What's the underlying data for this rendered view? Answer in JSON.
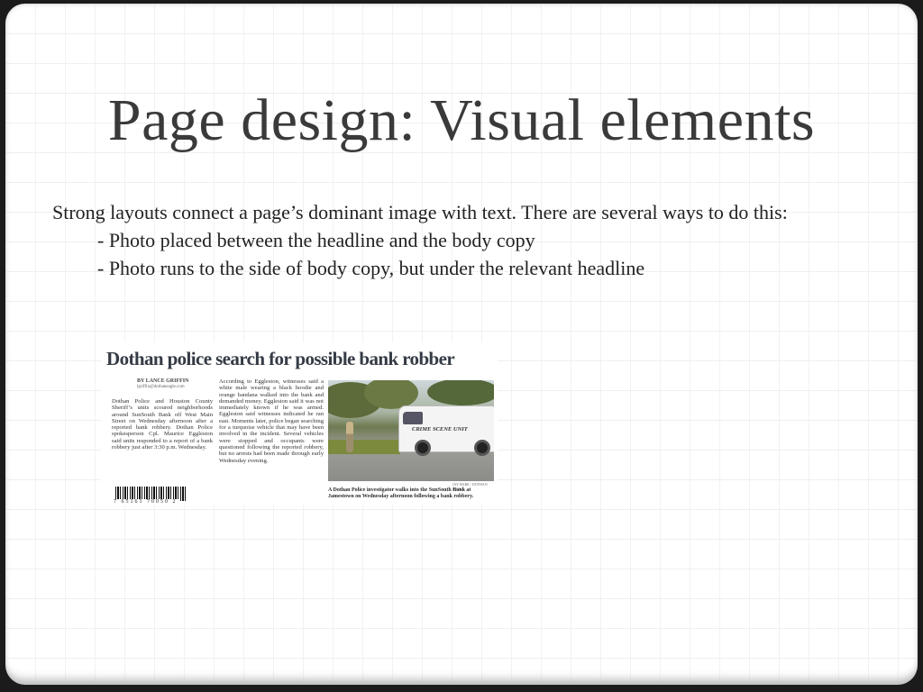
{
  "slide": {
    "title": "Page design: Visual elements",
    "body_line1": "Strong layouts connect a page’s dominant image with text. There are several ways to do this:",
    "bullets": [
      "- Photo placed between the headline and the body copy",
      "- Photo runs to the side of body copy, but under the relevant headline"
    ]
  },
  "clipping": {
    "headline": "Dothan police search for possible bank robber",
    "byline": "BY LANCE GRIFFIN",
    "email": "lgriffin@dothaneagle.com",
    "col1": "Dothan Police and Houston County Sheriff’s units scoured neighborhoods around SunSouth Bank off West Main Street on Wednesday afternoon after a reported bank robbery. Dothan Police spokesperson Cpl. Maurice Eggleston said units responded to a report of a bank robbery just after 3:30 p.m. Wednesday.",
    "col2": "According to Eggleston, witnesses said a white male wearing a black hoodie and orange bandana walked into the bank and demanded money. Eggleston said it was not immediately known if he was armed. Eggleston said witnesses indicated he ran east. Moments later, police began searching for a turquoise vehicle that may have been involved in the incident. Several vehicles were stopped and occupants were questioned following the reported robbery, but no arrests had been made through early Wednesday evening.",
    "van_text": "CRIME SCENE UNIT",
    "photo_credit": "JAY HARE / DOTHAN EAGLE",
    "caption": "A Dothan Police investigator walks into the SunSouth Bank at Jamestown on Wednesday afternoon following a bank robbery.",
    "barcode_number": "7 65161 70050 2"
  }
}
